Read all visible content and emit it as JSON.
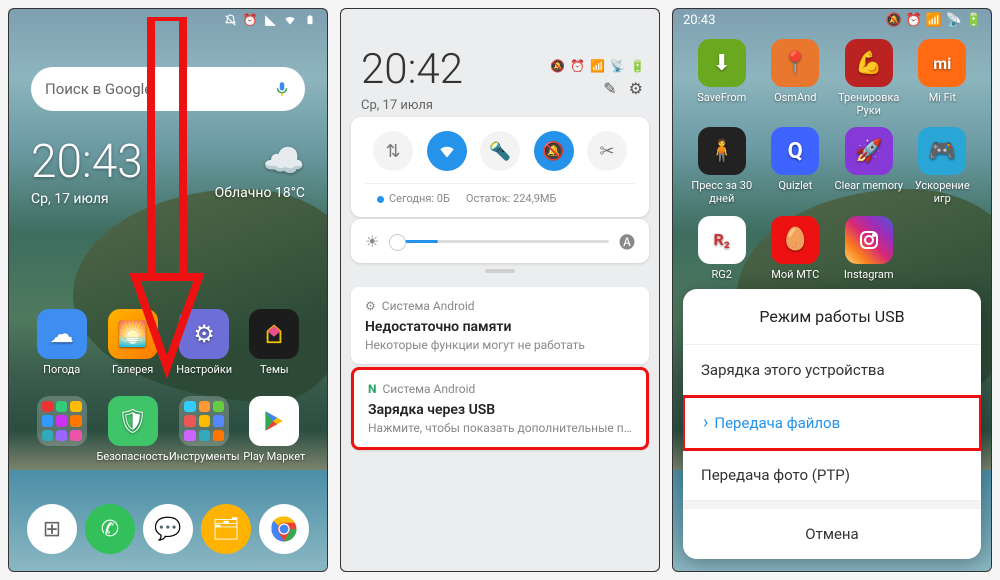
{
  "panel1": {
    "status_icons": [
      "silent",
      "alarm",
      "signal",
      "wifi",
      "battery"
    ],
    "search_placeholder": "Поиск в Google",
    "clock": {
      "time": "20:43",
      "date": "Ср, 17 июля"
    },
    "weather": {
      "cond": "Облачно",
      "temp": "18°C"
    },
    "apps_row1": [
      {
        "name": "Погода",
        "color": "#3e8df0"
      },
      {
        "name": "Галерея",
        "color": "#ffb300"
      },
      {
        "name": "Настройки",
        "color": "#6d6fd6"
      },
      {
        "name": "Темы",
        "color": "#1c1c1c"
      }
    ],
    "apps_row2": [
      {
        "name": "",
        "folder": true
      },
      {
        "name": "Безопасность",
        "color": "#3fc46a"
      },
      {
        "name": "Инструменты",
        "folder": true
      },
      {
        "name": "Play Маркет",
        "play": true
      }
    ],
    "dock": [
      {
        "name": "dialer",
        "color": "#ffffff",
        "fg": "#555"
      },
      {
        "name": "phone",
        "color": "#33c05a",
        "glyph": "✆"
      },
      {
        "name": "sms",
        "color": "#ffffff",
        "fg": "#555",
        "glyph": "✉"
      },
      {
        "name": "files",
        "color": "#ffb300",
        "glyph": "📁"
      },
      {
        "name": "chrome",
        "chrome": true
      }
    ]
  },
  "panel2": {
    "clock": {
      "time": "20:42",
      "date": "Ср, 17 июля"
    },
    "toggles": [
      {
        "name": "data",
        "on": false
      },
      {
        "name": "wifi",
        "on": true
      },
      {
        "name": "flashlight",
        "on": false
      },
      {
        "name": "dnd",
        "on": true
      },
      {
        "name": "screenshot",
        "on": false
      }
    ],
    "data_today": "Сегодня: 0Б",
    "data_remain": "Остаток: 224,9МБ",
    "notif1": {
      "source": "Система Android",
      "title": "Недостаточно памяти",
      "subtitle": "Некоторые функции могут не работать"
    },
    "notif2": {
      "source": "Система Android",
      "title": "Зарядка через USB",
      "subtitle": "Нажмите, чтобы показать дополнительные параметр..."
    }
  },
  "panel3": {
    "time": "20:43",
    "apps_row1": [
      {
        "name": "SaveFrom",
        "color": "#6aa91f",
        "glyph": "⬇"
      },
      {
        "name": "OsmAnd",
        "color": "#e9782e",
        "glyph": "📍"
      },
      {
        "name": "Тренировка Руки",
        "color": "#b22",
        "glyph": "💪"
      },
      {
        "name": "Mi Fit",
        "color": "#ff6a13",
        "glyph": "mi"
      }
    ],
    "apps_row2": [
      {
        "name": "Пресс за 30 дней",
        "color": "#222",
        "glyph": "🏋"
      },
      {
        "name": "Quizlet",
        "color": "#3d64ff",
        "glyph": "Q"
      },
      {
        "name": "Clear memory",
        "color": "#8639d6",
        "glyph": "🚀"
      },
      {
        "name": "Ускорение игр",
        "color": "#2aa6d6",
        "glyph": "🎮"
      }
    ],
    "apps_row3": [
      {
        "name": "RG2",
        "color": "#ffffff",
        "glyph": "R²",
        "fg": "#c33"
      },
      {
        "name": "Мой МТС",
        "color": "#e11",
        "glyph": "⬭"
      },
      {
        "name": "Instagram",
        "ig": true
      },
      {
        "name": "",
        "empty": true
      }
    ],
    "sheet": {
      "title": "Режим работы USB",
      "opt1": "Зарядка этого устройства",
      "opt2": "Передача файлов",
      "opt3": "Передача фото (PTP)",
      "cancel": "Отмена"
    }
  }
}
